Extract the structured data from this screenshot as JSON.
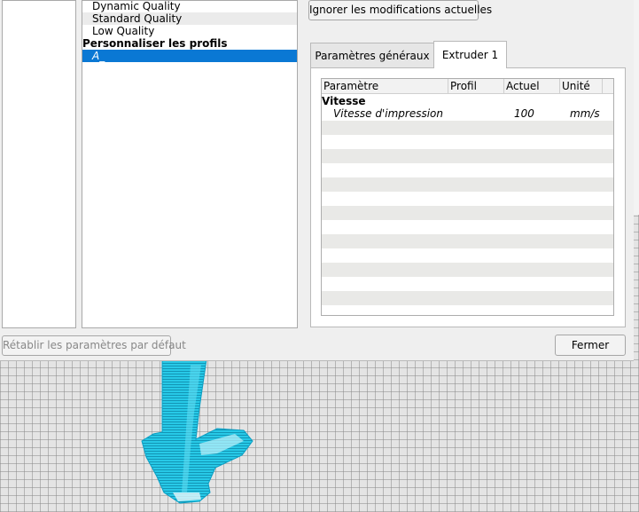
{
  "profiles": {
    "items": [
      {
        "label": "Dynamic Quality"
      },
      {
        "label": "Standard Quality"
      },
      {
        "label": "Low Quality"
      }
    ],
    "custom_header": "Personnaliser les profils",
    "selected_custom": "A_"
  },
  "buttons": {
    "ignore_changes": "Ignorer les modifications actuelles",
    "reset_defaults": "Rétablir les paramètres par défaut",
    "close": "Fermer"
  },
  "tabs": [
    {
      "label": "Paramètres généraux",
      "active": false
    },
    {
      "label": "Extruder 1",
      "active": true
    }
  ],
  "table": {
    "columns": [
      "Paramètre",
      "Profil",
      "Actuel",
      "Unité"
    ],
    "section": "Vitesse",
    "rows": [
      {
        "parameter": "Vitesse d'impression",
        "profile": "",
        "current": "100",
        "unit": "mm/s"
      }
    ]
  },
  "colors": {
    "selection": "#0a78d4",
    "model": "#1ec8e6",
    "grid_background": "#e4e4e4"
  }
}
